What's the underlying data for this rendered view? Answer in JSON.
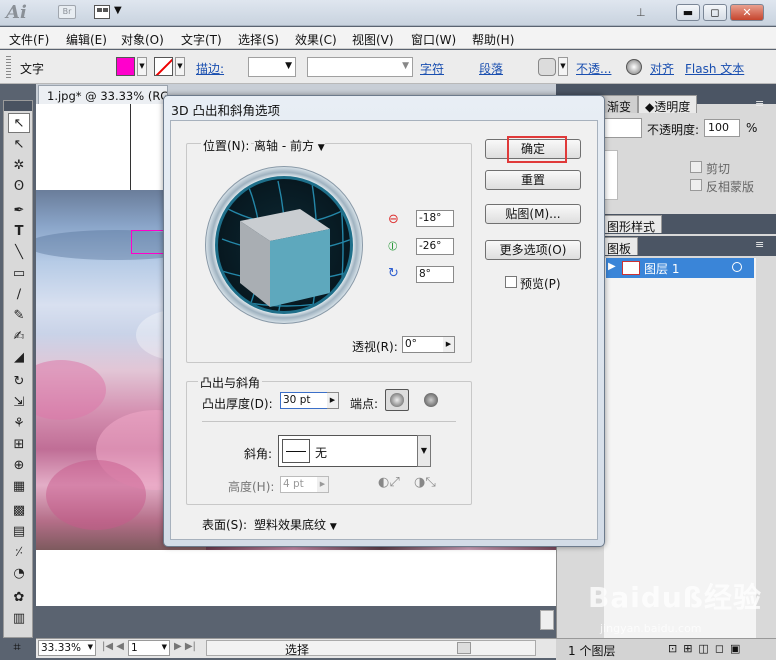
{
  "titlebar": {
    "logo": "Ai",
    "bridge": "Br",
    "pin_icon": "⊥"
  },
  "menubar": [
    "文件(F)",
    "编辑(E)",
    "对象(O)",
    "文字(T)",
    "选择(S)",
    "效果(C)",
    "视图(V)",
    "窗口(W)",
    "帮助(H)"
  ],
  "control": {
    "object_label": "文字",
    "fill_color": "#ff00cc",
    "stroke_label": "描边:",
    "char_link": "字符",
    "para_link": "段落",
    "opacity_link": "不透...",
    "align_link": "对齐",
    "flash_link": "Flash 文本"
  },
  "document": {
    "tab_title": "1.jpg* @ 33.33% (RGB/预览)",
    "close_icon": "×"
  },
  "status": {
    "zoom": "33.33%",
    "page": "1",
    "mode": "选择"
  },
  "panels": {
    "tab_gradient": "渐变",
    "tab_transparency": "透明度",
    "opacity_label": "不透明度:",
    "opacity_value": "100",
    "opacity_unit": "%",
    "clip_label": "剪切",
    "invert_mask_label": "反相蒙版",
    "graphic_styles_tab": "图形样式",
    "layers_tab": "图板",
    "layer_name": "图层 1",
    "layer_count": "1 个图层"
  },
  "dialog": {
    "title": "3D 凸出和斜角选项",
    "position_label": "位置(N):",
    "position_value": "离轴 - 前方",
    "rot_x": "-18°",
    "rot_y": "-26°",
    "rot_z": "8°",
    "perspective_label": "透视(R):",
    "perspective_value": "0°",
    "extrude_group": "凸出与斜角",
    "extrude_depth_label": "凸出厚度(D):",
    "extrude_depth_value": "30 pt",
    "cap_label": "端点:",
    "bevel_label": "斜角:",
    "bevel_value": "无",
    "height_label": "高度(H):",
    "height_value": "4 pt",
    "surface_label": "表面(S):",
    "surface_value": "塑料效果底纹",
    "ok": "确定",
    "reset": "重置",
    "map_art": "贴图(M)...",
    "more_options": "更多选项(O)",
    "preview": "预览(P)"
  },
  "watermark": {
    "brand": "Baiduß经验",
    "url": "jingyan.baidu.com"
  }
}
